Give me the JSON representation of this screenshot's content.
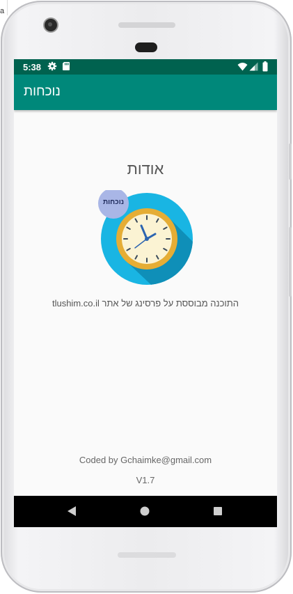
{
  "desktop": {
    "fragment_left": "a"
  },
  "status_bar": {
    "time": "5:38",
    "icons": [
      "settings-gear-icon",
      "sd-card-icon",
      "wifi-icon",
      "signal-icon",
      "battery-icon"
    ]
  },
  "toolbar": {
    "title": "נוכחות"
  },
  "main": {
    "about_title": "אודות",
    "logo": {
      "badge_text": "נוכחות",
      "icon": "clock-icon"
    },
    "description": "התוכנה מבוססת על פרסינג של אתר tlushim.co.il",
    "coded_by": "Coded by Gchaimke@gmail.com",
    "version": "V1.7"
  },
  "nav_bar": {
    "buttons": [
      "back-icon",
      "home-icon",
      "recents-icon"
    ]
  },
  "colors": {
    "status_bar": "#00624f",
    "toolbar": "#00887a",
    "screen_background": "#fafafa",
    "logo_circle": "#19b5e3",
    "logo_badge": "#a9b6e6",
    "clock_rim": "#e5ad35",
    "clock_face": "#fbf3d3"
  }
}
